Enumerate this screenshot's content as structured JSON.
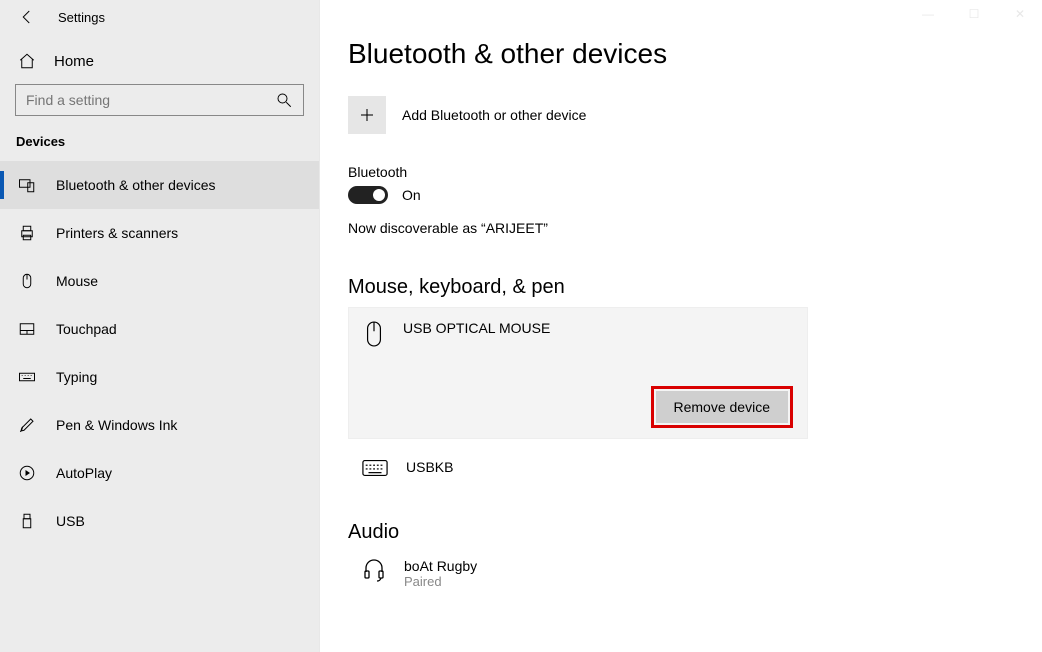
{
  "titlebar": {
    "title": "Settings"
  },
  "sidebar": {
    "home": "Home",
    "search_placeholder": "Find a setting",
    "section": "Devices",
    "items": [
      {
        "label": "Bluetooth & other devices"
      },
      {
        "label": "Printers & scanners"
      },
      {
        "label": "Mouse"
      },
      {
        "label": "Touchpad"
      },
      {
        "label": "Typing"
      },
      {
        "label": "Pen & Windows Ink"
      },
      {
        "label": "AutoPlay"
      },
      {
        "label": "USB"
      }
    ]
  },
  "main": {
    "title": "Bluetooth & other devices",
    "add_label": "Add Bluetooth or other device",
    "bt_label": "Bluetooth",
    "bt_state": "On",
    "discover_text": "Now discoverable as “ARIJEET”",
    "group_mouse": "Mouse, keyboard, & pen",
    "device1": {
      "name": "USB OPTICAL MOUSE",
      "remove": "Remove device"
    },
    "device2": {
      "name": "USBKB"
    },
    "group_audio": "Audio",
    "audio1": {
      "name": "boAt Rugby",
      "status": "Paired"
    }
  }
}
